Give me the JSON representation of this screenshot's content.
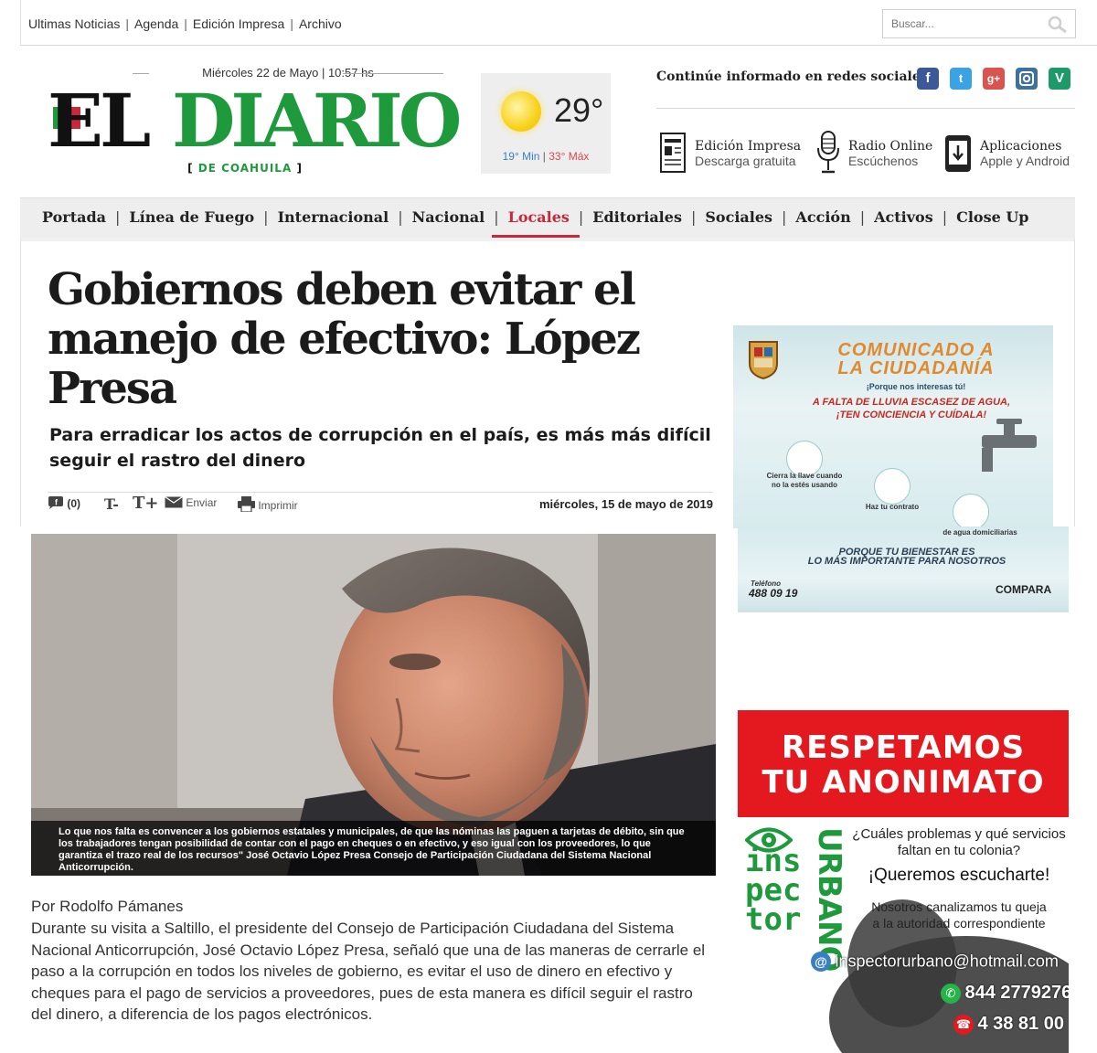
{
  "topbar": {
    "links": [
      "Ultimas Noticias",
      "Agenda",
      "Edición Impresa",
      "Archivo"
    ],
    "search_placeholder": "Buscar..."
  },
  "header": {
    "datetime": "Miércoles 22 de Mayo | 10:57 hs",
    "logo_el": "EL",
    "logo_diario": "DIARIO",
    "logo_sub": "DE COAHUILA",
    "weather": {
      "temp": "29°",
      "min": "19° Min",
      "max": "33° Máx"
    },
    "social_label": "Continúe informado en redes sociales",
    "social_icons": [
      "facebook-icon",
      "twitter-icon",
      "googleplus-icon",
      "instagram-icon",
      "vine-icon"
    ],
    "services": [
      {
        "title": "Edición Impresa",
        "sub": "Descarga gratuita"
      },
      {
        "title": "Radio Online",
        "sub": "Escúchenos"
      },
      {
        "title": "Aplicaciones",
        "sub": "Apple y Android"
      }
    ]
  },
  "nav": {
    "items": [
      "Portada",
      "Línea de Fuego",
      "Internacional",
      "Nacional",
      "Locales",
      "Editoriales",
      "Sociales",
      "Acción",
      "Activos",
      "Close Up"
    ],
    "active": "Locales"
  },
  "article": {
    "headline": "Gobiernos deben evitar el manejo de efectivo: López Presa",
    "subhead": "Para erradicar los actos de corrupción en el país, es más más difícil seguir el rastro del dinero",
    "fb_count": "(0)",
    "tool_text_minus": "T-",
    "tool_text_plus": "T+",
    "tool_send": "Enviar",
    "tool_print": "Imprimir",
    "date": "miércoles, 15 de mayo de 2019",
    "caption": "Lo que nos falta es convencer a los gobiernos estatales y municipales, de que las nóminas las paguen a tarjetas de débito, sin que los trabajadores tengan posibilidad de contar con el pago en cheques o en efectivo, y eso igual con los proveedores, lo que garantiza el trazo real de los recursos\" José Octavio López Presa Consejo de Participación Ciudadana del Sistema Nacional Anticorrupción.",
    "author": "Por Rodolfo Pámanes",
    "body": "Durante su visita a Saltillo, el presidente del Consejo de Participación Ciudadana del Sistema Nacional Anticorrupción, José Octavio López Presa, señaló que una de las maneras de cerrarle el paso a la corrupción en todos los niveles de gobierno, es evitar el uso de dinero en efectivo y cheques para el pago de servicios a proveedores, pues de esta manera es difícil seguir el rastro del dinero, a diferencia de los pagos electrónicos."
  },
  "ad_comunicado": {
    "title1": "COMUNICADO A",
    "title2": "LA CIUDADANÍA",
    "tag": "¡Porque nos interesas tú!",
    "warn1": "A FALTA DE LLUVIA ESCASEZ DE AGUA,",
    "warn2": "¡TEN CONCIENCIA Y CUÍDALA!",
    "tip1a": "Cierra la llave cuando",
    "tip1b": "no la estés usando",
    "tip2": "Haz tu contrato",
    "tip3": "de agua domiciliarias",
    "slogan1": "PORQUE TU BIENESTAR ES",
    "slogan2": "LO MÁS IMPORTANTE PARA NOSOTROS",
    "phone_label": "Teléfono",
    "phone": "488 09 19",
    "brand": "COMPARA"
  },
  "ad_inspector": {
    "banner1": "RESPETAMOS",
    "banner2": "TU ANONIMATO",
    "logo_lines": [
      "ins",
      "pec",
      "tor"
    ],
    "logo_vertical": "URBANO",
    "q1": "¿Cuáles problemas y qué servicios",
    "q2": "faltan en tu colonia?",
    "cta": "¡Queremos escucharte!",
    "c1": "Nosotros canalizamos tu queja",
    "c2": "a la autoridad correspondiente",
    "email": "inspectorurbano@hotmail.com",
    "whatsapp": "844 2779276",
    "phone": "4 38 81 00"
  },
  "colors": {
    "brand_green": "#1e9a3c",
    "accent_red": "#c8283a",
    "nav_bg": "#eeeeee"
  }
}
